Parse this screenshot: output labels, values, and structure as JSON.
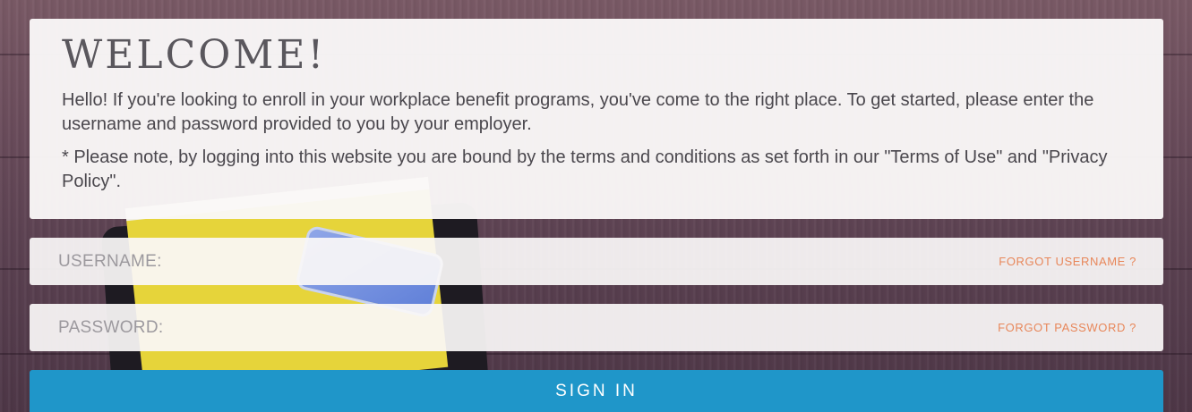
{
  "welcome": {
    "title": "WELCOME!",
    "intro": "Hello! If you're looking to enroll in your workplace benefit programs, you've come to the right place. To get started, please enter the username and password provided to you by your employer.",
    "note": "* Please note, by logging into this website you are bound by the terms and conditions as set forth in our \"Terms of Use\" and \"Privacy Policy\"."
  },
  "login": {
    "username_placeholder": "USERNAME:",
    "username_value": "",
    "forgot_username": "FORGOT USERNAME ?",
    "password_placeholder": "PASSWORD:",
    "password_value": "",
    "forgot_password": "FORGOT PASSWORD ?",
    "sign_in_label": "SIGN IN"
  },
  "colors": {
    "accent": "#1f96c9",
    "link": "#e8875a"
  }
}
